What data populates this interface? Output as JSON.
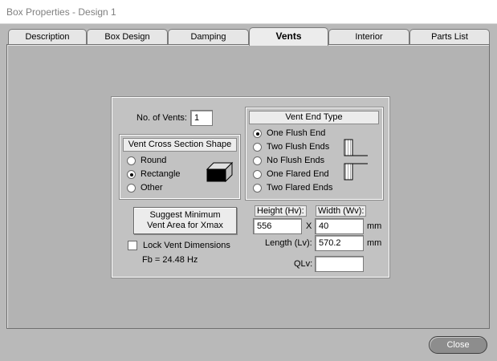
{
  "window": {
    "title": "Box Properties - Design 1"
  },
  "tabs": [
    {
      "label": "Description",
      "active": false
    },
    {
      "label": "Box Design",
      "active": false
    },
    {
      "label": "Damping",
      "active": false
    },
    {
      "label": "Vents",
      "active": true
    },
    {
      "label": "Interior",
      "active": false
    },
    {
      "label": "Parts List",
      "active": false
    }
  ],
  "vents": {
    "count_label": "No. of Vents:",
    "count_value": "1",
    "cross_section": {
      "title": "Vent Cross Section Shape",
      "options": [
        "Round",
        "Rectangle",
        "Other"
      ],
      "selected": "Rectangle"
    },
    "end_type": {
      "title": "Vent End Type",
      "options": [
        "One Flush End",
        "Two Flush Ends",
        "No Flush Ends",
        "One Flared End",
        "Two Flared Ends"
      ],
      "selected": "One Flush End"
    },
    "suggest_button": {
      "line1": "Suggest Minimum",
      "line2": "Vent Area for Xmax"
    },
    "lock_label": "Lock Vent Dimensions",
    "lock_checked": false,
    "fb_text": "Fb = 24.48 Hz",
    "height": {
      "label": "Height (Hv):",
      "value": "556"
    },
    "x_label": "X",
    "width": {
      "label": "Width (Wv):",
      "value": "40"
    },
    "mm_label": "mm",
    "length": {
      "label": "Length (Lv):",
      "value": "570.2"
    },
    "qlv": {
      "label": "QLv:",
      "value": ""
    }
  },
  "footer": {
    "close_label": "Close"
  }
}
